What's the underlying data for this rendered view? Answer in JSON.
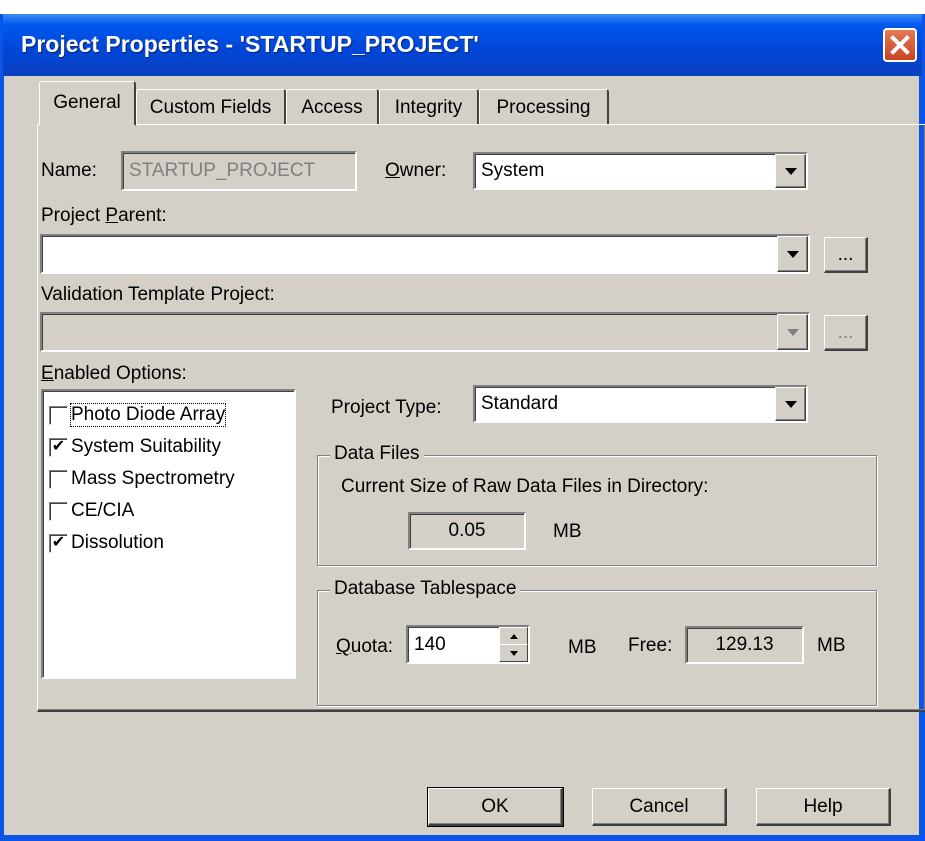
{
  "window": {
    "title": "Project Properties - 'STARTUP_PROJECT'",
    "close_glyph": "✕"
  },
  "tabs": [
    {
      "label": "General",
      "active": true
    },
    {
      "label": "Custom Fields",
      "active": false
    },
    {
      "label": "Access",
      "active": false
    },
    {
      "label": "Integrity",
      "active": false
    },
    {
      "label": "Processing",
      "active": false
    }
  ],
  "general": {
    "name_label": "Name:",
    "name_value": "STARTUP_PROJECT",
    "owner_label_accel": "O",
    "owner_label_rest": "wner:",
    "owner_value": "System",
    "parent_label_pre": "Project ",
    "parent_label_accel": "P",
    "parent_label_post": "arent:",
    "parent_value": "",
    "parent_browse": "...",
    "template_label": "Validation Template Project:",
    "template_value": "",
    "template_browse": "...",
    "enabled_label_accel": "E",
    "enabled_label_rest": "nabled Options:",
    "options": [
      {
        "label": "Photo Diode Array",
        "checked": false,
        "focused": true
      },
      {
        "label": "System Suitability",
        "checked": true,
        "focused": false
      },
      {
        "label": "Mass Spectrometry",
        "checked": false,
        "focused": false
      },
      {
        "label": "CE/CIA",
        "checked": false,
        "focused": false
      },
      {
        "label": "Dissolution",
        "checked": true,
        "focused": false
      }
    ],
    "project_type_label": "Project Type:",
    "project_type_value": "Standard",
    "data_files": {
      "legend": "Data Files",
      "desc": "Current Size of Raw Data Files in Directory:",
      "size": "0.05",
      "unit": "MB"
    },
    "tablespace": {
      "legend": "Database Tablespace",
      "quota_label_accel": "Q",
      "quota_label_rest": "uota:",
      "quota_value": "140",
      "quota_unit": "MB",
      "free_label": "Free:",
      "free_value": "129.13",
      "free_unit": "MB"
    }
  },
  "buttons": {
    "ok": "OK",
    "cancel": "Cancel",
    "help": "Help"
  },
  "colors": {
    "titlebar": "#0054E3",
    "dialog_face": "#D4D0C8",
    "close_button": "#D5532D"
  }
}
